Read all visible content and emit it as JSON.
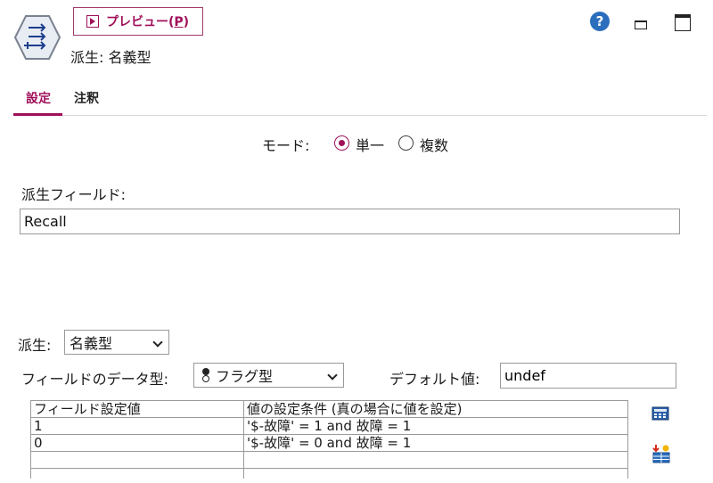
{
  "header": {
    "preview_button": "プレビュー(P)",
    "preview_label_main": "プレビュー(",
    "preview_label_key": "P",
    "preview_label_end": ")",
    "node_title": "派生: 名義型",
    "help_glyph": "?"
  },
  "tabs": [
    {
      "label": "設定",
      "active": true
    },
    {
      "label": "注釈",
      "active": false
    }
  ],
  "mode": {
    "label": "モード:",
    "options": [
      {
        "label": "単一",
        "selected": true
      },
      {
        "label": "複数",
        "selected": false
      }
    ]
  },
  "derive_field": {
    "label": "派生フィールド:",
    "value": "Recall"
  },
  "derive_as": {
    "label": "派生:",
    "value": "名義型"
  },
  "field_type": {
    "label": "フィールドのデータ型:",
    "value": "フラグ型"
  },
  "default_value": {
    "label": "デフォルト値:",
    "value": "undef"
  },
  "table": {
    "headers": [
      "フィールド設定値",
      "値の設定条件 (真の場合に値を設定)"
    ],
    "rows": [
      [
        "1",
        "'$-故障' = 1 and 故障 = 1"
      ],
      [
        "0",
        "'$-故障' = 0 and 故障 = 1"
      ]
    ]
  },
  "colors": {
    "accent": "#a0105a",
    "help": "#2a6ebd"
  },
  "icons": {
    "node": "derive-node-icon",
    "help": "help-icon",
    "minimize": "minimize-icon",
    "maximize": "maximize-icon",
    "expression_builder": "calculator-icon",
    "import_values": "import-values-icon"
  }
}
